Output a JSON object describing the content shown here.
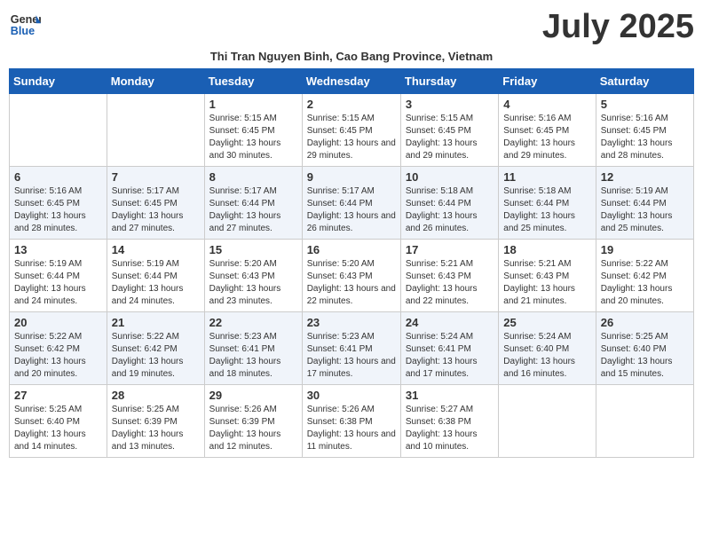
{
  "header": {
    "logo_line1": "General",
    "logo_line2": "Blue",
    "month_year": "July 2025",
    "subtitle": "Thi Tran Nguyen Binh, Cao Bang Province, Vietnam"
  },
  "weekdays": [
    "Sunday",
    "Monday",
    "Tuesday",
    "Wednesday",
    "Thursday",
    "Friday",
    "Saturday"
  ],
  "weeks": [
    [
      {
        "day": "",
        "info": ""
      },
      {
        "day": "",
        "info": ""
      },
      {
        "day": "1",
        "info": "Sunrise: 5:15 AM\nSunset: 6:45 PM\nDaylight: 13 hours and 30 minutes."
      },
      {
        "day": "2",
        "info": "Sunrise: 5:15 AM\nSunset: 6:45 PM\nDaylight: 13 hours and 29 minutes."
      },
      {
        "day": "3",
        "info": "Sunrise: 5:15 AM\nSunset: 6:45 PM\nDaylight: 13 hours and 29 minutes."
      },
      {
        "day": "4",
        "info": "Sunrise: 5:16 AM\nSunset: 6:45 PM\nDaylight: 13 hours and 29 minutes."
      },
      {
        "day": "5",
        "info": "Sunrise: 5:16 AM\nSunset: 6:45 PM\nDaylight: 13 hours and 28 minutes."
      }
    ],
    [
      {
        "day": "6",
        "info": "Sunrise: 5:16 AM\nSunset: 6:45 PM\nDaylight: 13 hours and 28 minutes."
      },
      {
        "day": "7",
        "info": "Sunrise: 5:17 AM\nSunset: 6:45 PM\nDaylight: 13 hours and 27 minutes."
      },
      {
        "day": "8",
        "info": "Sunrise: 5:17 AM\nSunset: 6:44 PM\nDaylight: 13 hours and 27 minutes."
      },
      {
        "day": "9",
        "info": "Sunrise: 5:17 AM\nSunset: 6:44 PM\nDaylight: 13 hours and 26 minutes."
      },
      {
        "day": "10",
        "info": "Sunrise: 5:18 AM\nSunset: 6:44 PM\nDaylight: 13 hours and 26 minutes."
      },
      {
        "day": "11",
        "info": "Sunrise: 5:18 AM\nSunset: 6:44 PM\nDaylight: 13 hours and 25 minutes."
      },
      {
        "day": "12",
        "info": "Sunrise: 5:19 AM\nSunset: 6:44 PM\nDaylight: 13 hours and 25 minutes."
      }
    ],
    [
      {
        "day": "13",
        "info": "Sunrise: 5:19 AM\nSunset: 6:44 PM\nDaylight: 13 hours and 24 minutes."
      },
      {
        "day": "14",
        "info": "Sunrise: 5:19 AM\nSunset: 6:44 PM\nDaylight: 13 hours and 24 minutes."
      },
      {
        "day": "15",
        "info": "Sunrise: 5:20 AM\nSunset: 6:43 PM\nDaylight: 13 hours and 23 minutes."
      },
      {
        "day": "16",
        "info": "Sunrise: 5:20 AM\nSunset: 6:43 PM\nDaylight: 13 hours and 22 minutes."
      },
      {
        "day": "17",
        "info": "Sunrise: 5:21 AM\nSunset: 6:43 PM\nDaylight: 13 hours and 22 minutes."
      },
      {
        "day": "18",
        "info": "Sunrise: 5:21 AM\nSunset: 6:43 PM\nDaylight: 13 hours and 21 minutes."
      },
      {
        "day": "19",
        "info": "Sunrise: 5:22 AM\nSunset: 6:42 PM\nDaylight: 13 hours and 20 minutes."
      }
    ],
    [
      {
        "day": "20",
        "info": "Sunrise: 5:22 AM\nSunset: 6:42 PM\nDaylight: 13 hours and 20 minutes."
      },
      {
        "day": "21",
        "info": "Sunrise: 5:22 AM\nSunset: 6:42 PM\nDaylight: 13 hours and 19 minutes."
      },
      {
        "day": "22",
        "info": "Sunrise: 5:23 AM\nSunset: 6:41 PM\nDaylight: 13 hours and 18 minutes."
      },
      {
        "day": "23",
        "info": "Sunrise: 5:23 AM\nSunset: 6:41 PM\nDaylight: 13 hours and 17 minutes."
      },
      {
        "day": "24",
        "info": "Sunrise: 5:24 AM\nSunset: 6:41 PM\nDaylight: 13 hours and 17 minutes."
      },
      {
        "day": "25",
        "info": "Sunrise: 5:24 AM\nSunset: 6:40 PM\nDaylight: 13 hours and 16 minutes."
      },
      {
        "day": "26",
        "info": "Sunrise: 5:25 AM\nSunset: 6:40 PM\nDaylight: 13 hours and 15 minutes."
      }
    ],
    [
      {
        "day": "27",
        "info": "Sunrise: 5:25 AM\nSunset: 6:40 PM\nDaylight: 13 hours and 14 minutes."
      },
      {
        "day": "28",
        "info": "Sunrise: 5:25 AM\nSunset: 6:39 PM\nDaylight: 13 hours and 13 minutes."
      },
      {
        "day": "29",
        "info": "Sunrise: 5:26 AM\nSunset: 6:39 PM\nDaylight: 13 hours and 12 minutes."
      },
      {
        "day": "30",
        "info": "Sunrise: 5:26 AM\nSunset: 6:38 PM\nDaylight: 13 hours and 11 minutes."
      },
      {
        "day": "31",
        "info": "Sunrise: 5:27 AM\nSunset: 6:38 PM\nDaylight: 13 hours and 10 minutes."
      },
      {
        "day": "",
        "info": ""
      },
      {
        "day": "",
        "info": ""
      }
    ]
  ]
}
